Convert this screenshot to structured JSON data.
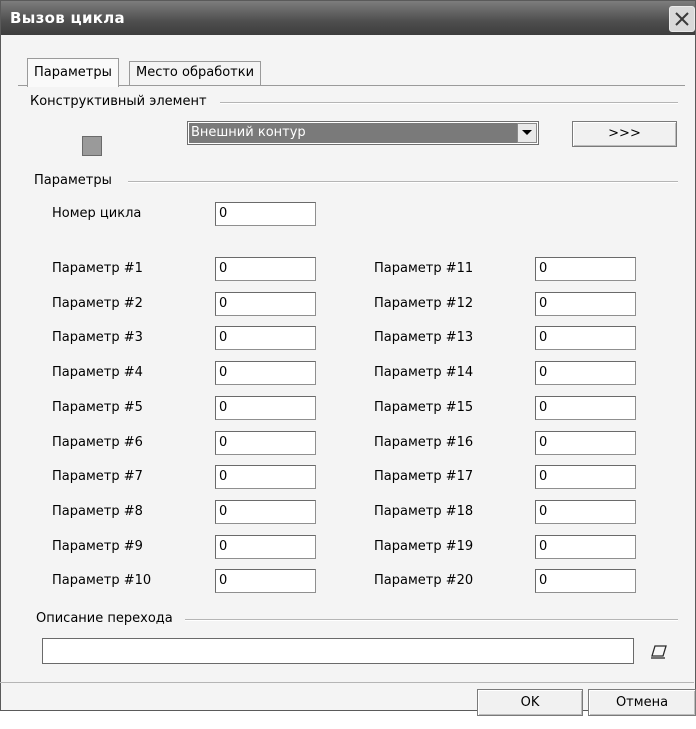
{
  "window": {
    "title": "Вызов цикла"
  },
  "tabs": [
    {
      "label": "Параметры",
      "active": true
    },
    {
      "label": "Место обработки",
      "active": false
    }
  ],
  "structural": {
    "group_label": "Конструктивный элемент",
    "select_value": "Внешний контур",
    "more_button": ">>>"
  },
  "params": {
    "group_label": "Параметры",
    "cycle_label": "Номер цикла",
    "cycle_value": "0",
    "left": [
      {
        "label": "Параметр #1",
        "value": "0"
      },
      {
        "label": "Параметр #2",
        "value": "0"
      },
      {
        "label": "Параметр #3",
        "value": "0"
      },
      {
        "label": "Параметр #4",
        "value": "0"
      },
      {
        "label": "Параметр #5",
        "value": "0"
      },
      {
        "label": "Параметр #6",
        "value": "0"
      },
      {
        "label": "Параметр #7",
        "value": "0"
      },
      {
        "label": "Параметр #8",
        "value": "0"
      },
      {
        "label": "Параметр #9",
        "value": "0"
      },
      {
        "label": "Параметр #10",
        "value": "0"
      }
    ],
    "right": [
      {
        "label": "Параметр #11",
        "value": "0"
      },
      {
        "label": "Параметр #12",
        "value": "0"
      },
      {
        "label": "Параметр #13",
        "value": "0"
      },
      {
        "label": "Параметр #14",
        "value": "0"
      },
      {
        "label": "Параметр #15",
        "value": "0"
      },
      {
        "label": "Параметр #16",
        "value": "0"
      },
      {
        "label": "Параметр #17",
        "value": "0"
      },
      {
        "label": "Параметр #18",
        "value": "0"
      },
      {
        "label": "Параметр #19",
        "value": "0"
      },
      {
        "label": "Параметр #20",
        "value": "0"
      }
    ]
  },
  "description": {
    "group_label": "Описание перехода",
    "value": "",
    "icon": "edit-icon"
  },
  "buttons": {
    "ok": "OK",
    "cancel": "Отмена"
  },
  "icons": {
    "close": "close-icon",
    "dropdown": "chevron-down-icon",
    "swatch": "color-swatch"
  }
}
